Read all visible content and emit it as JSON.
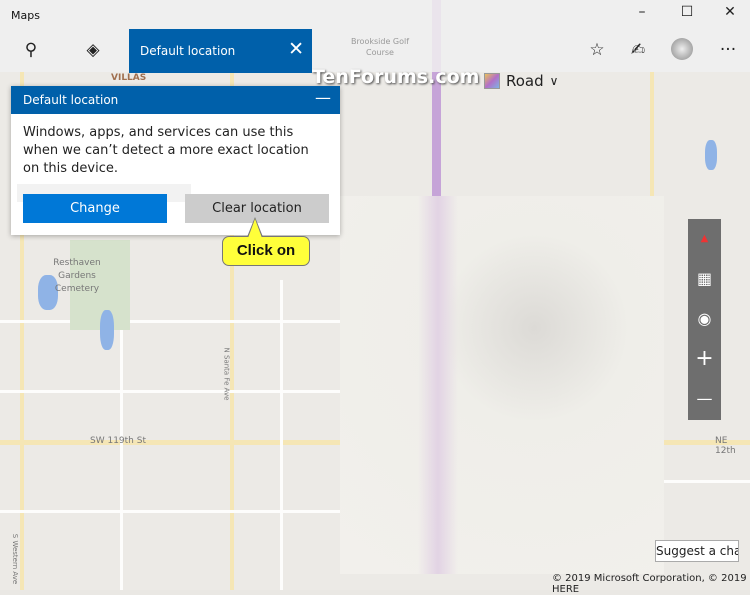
{
  "window": {
    "title": "Maps",
    "minimize": "–",
    "maximize": "☐",
    "close": "✕"
  },
  "toolbar": {
    "search_icon": "search-icon",
    "directions_icon": "directions-icon",
    "map_style": "Road",
    "favorites_icon": "favorites-icon",
    "ink_icon": "ink-icon",
    "more": "···"
  },
  "tab": {
    "label": "Default location",
    "close": "✕"
  },
  "watermark": "TenForums.com",
  "panel": {
    "title": "Default location",
    "minimize": "—",
    "text": "Windows, apps, and services can use this when we can’t detect a more exact location on this device.",
    "change": "Change",
    "clear": "Clear location"
  },
  "callout": "Click on",
  "map_labels": {
    "villas": "VILLAS",
    "cemetery": "Resthaven Gardens Cemetery",
    "sw119": "SW 119th St",
    "ne12": "NE 12th",
    "santafe": "N Santa Fe Ave",
    "western": "S Western Ave",
    "golf": "Brookside Golf Course"
  },
  "controls": {
    "compass": "▲",
    "tilt": "▦",
    "locate": "◉",
    "zoom_in": "+",
    "zoom_out": "—"
  },
  "suggest": "Suggest a change",
  "copyright": "© 2019 Microsoft Corporation, © 2019 HERE"
}
